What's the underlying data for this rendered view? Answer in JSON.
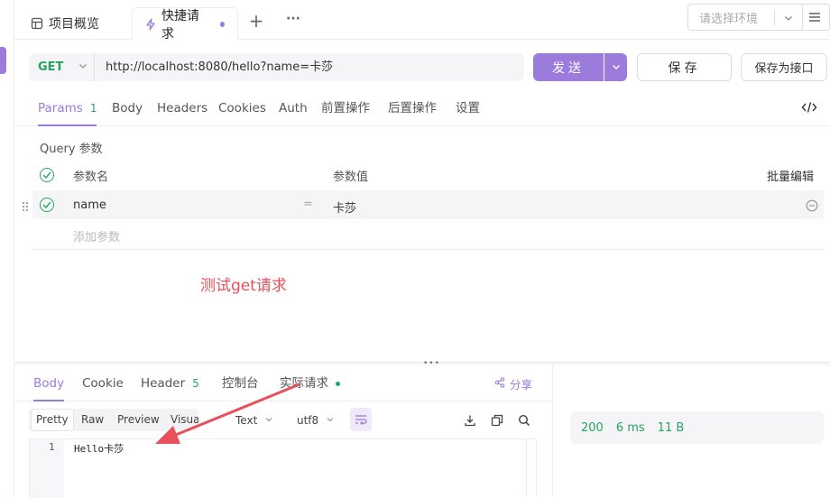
{
  "tabs": {
    "overview_label": "项目概览",
    "quick_request_label": "快捷请求",
    "add_symbol": "+",
    "more_symbol": "···"
  },
  "environment": {
    "placeholder": "请选择环境"
  },
  "request": {
    "method": "GET",
    "url": "http://localhost:8080/hello?name=卡莎",
    "send_label": "发送",
    "save_label": "保存",
    "save_as_label": "保存为接口"
  },
  "request_tabs": [
    {
      "label": "Params",
      "count": "1"
    },
    {
      "label": "Body"
    },
    {
      "label": "Headers"
    },
    {
      "label": "Cookies"
    },
    {
      "label": "Auth"
    },
    {
      "label": "前置操作"
    },
    {
      "label": "后置操作"
    },
    {
      "label": "设置"
    }
  ],
  "params": {
    "section_label": "Query 参数",
    "col_name": "参数名",
    "col_value": "参数值",
    "bulk_edit": "批量编辑",
    "rows": [
      {
        "name": "name",
        "eq": "=",
        "value": "卡莎"
      }
    ],
    "add_placeholder": "添加参数"
  },
  "annotation": {
    "text": "测试get请求",
    "color": "#e8505b"
  },
  "response_tabs": [
    {
      "label": "Body"
    },
    {
      "label": "Cookie"
    },
    {
      "label": "Header",
      "count": "5"
    },
    {
      "label": "控制台"
    },
    {
      "label": "实际请求"
    }
  ],
  "share_label": "分享",
  "format_tabs": [
    "Pretty",
    "Raw",
    "Preview",
    "Visualize"
  ],
  "selects": {
    "type": "Text",
    "encoding": "utf8"
  },
  "editor": {
    "line_number": "1",
    "content": "Hello卡莎"
  },
  "status": {
    "code": "200",
    "time": "6 ms",
    "size": "11 B"
  },
  "colors": {
    "accent": "#9b7bdc",
    "success": "#27a35f",
    "annotation": "#e8505b"
  }
}
